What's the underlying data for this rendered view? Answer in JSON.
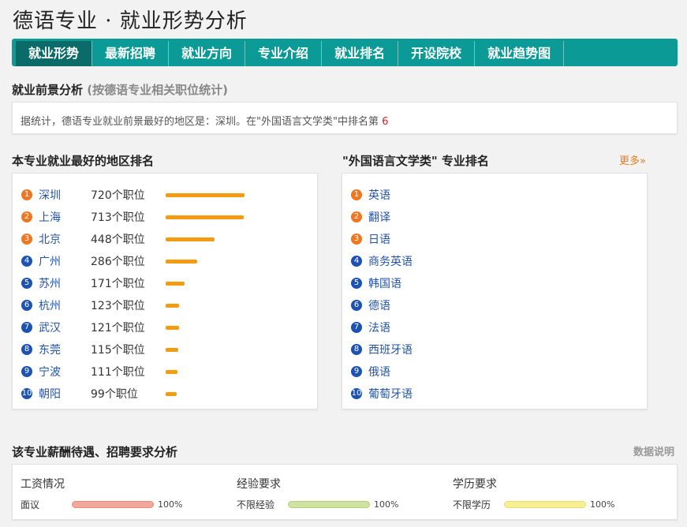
{
  "page_title": "德语专业 · 就业形势分析",
  "nav": {
    "tabs": [
      {
        "label": "就业形势",
        "active": true
      },
      {
        "label": "最新招聘"
      },
      {
        "label": "就业方向"
      },
      {
        "label": "专业介绍"
      },
      {
        "label": "就业排名"
      },
      {
        "label": "开设院校"
      },
      {
        "label": "就业趋势图"
      }
    ]
  },
  "prospect": {
    "title": "就业前景分析",
    "subtitle": "(按德语专业相关职位统计)",
    "summary_text": "据统计，德语专业就业前景最好的地区是：深圳。在\"外国语言文学类\"中排名第",
    "summary_rank": "6"
  },
  "regions": {
    "title": "本专业就业最好的地区排名",
    "items": [
      {
        "rank": "1",
        "name": "深圳",
        "count": "720个职位",
        "value": 720
      },
      {
        "rank": "2",
        "name": "上海",
        "count": "713个职位",
        "value": 713
      },
      {
        "rank": "3",
        "name": "北京",
        "count": "448个职位",
        "value": 448
      },
      {
        "rank": "4",
        "name": "广州",
        "count": "286个职位",
        "value": 286
      },
      {
        "rank": "5",
        "name": "苏州",
        "count": "171个职位",
        "value": 171
      },
      {
        "rank": "6",
        "name": "杭州",
        "count": "123个职位",
        "value": 123
      },
      {
        "rank": "7",
        "name": "武汉",
        "count": "121个职位",
        "value": 121
      },
      {
        "rank": "8",
        "name": "东莞",
        "count": "115个职位",
        "value": 115
      },
      {
        "rank": "9",
        "name": "宁波",
        "count": "111个职位",
        "value": 111
      },
      {
        "rank": "10",
        "name": "朝阳",
        "count": "99个职位",
        "value": 99
      }
    ]
  },
  "majors": {
    "title": "\"外国语言文学类\" 专业排名",
    "more_label": "更多»",
    "items": [
      {
        "rank": "1",
        "name": "英语"
      },
      {
        "rank": "2",
        "name": "翻译"
      },
      {
        "rank": "3",
        "name": "日语"
      },
      {
        "rank": "4",
        "name": "商务英语"
      },
      {
        "rank": "5",
        "name": "韩国语"
      },
      {
        "rank": "6",
        "name": "德语"
      },
      {
        "rank": "7",
        "name": "法语"
      },
      {
        "rank": "8",
        "name": "西班牙语"
      },
      {
        "rank": "9",
        "name": "俄语"
      },
      {
        "rank": "10",
        "name": "葡萄牙语"
      }
    ]
  },
  "salary": {
    "title": "该专业薪酬待遇、招聘要求分析",
    "data_note": "数据说明",
    "columns": [
      {
        "title": "工资情况",
        "label": "面议",
        "percent": "100%",
        "fraction": 1.0,
        "color": "#f3a69a"
      },
      {
        "title": "经验要求",
        "label": "不限经验",
        "percent": "100%",
        "fraction": 1.0,
        "color": "#cfe2a2"
      },
      {
        "title": "学历要求",
        "label": "不限学历",
        "percent": "100%",
        "fraction": 1.0,
        "color": "#f7ef94"
      }
    ]
  },
  "colors": {
    "brand_teal": "#0b9a96",
    "nav_active": "#0b6b68",
    "bar_orange": "#f39c12",
    "badge_top": "#ee7722",
    "badge_rest": "#1c52b0",
    "link_blue": "#2453a6"
  }
}
